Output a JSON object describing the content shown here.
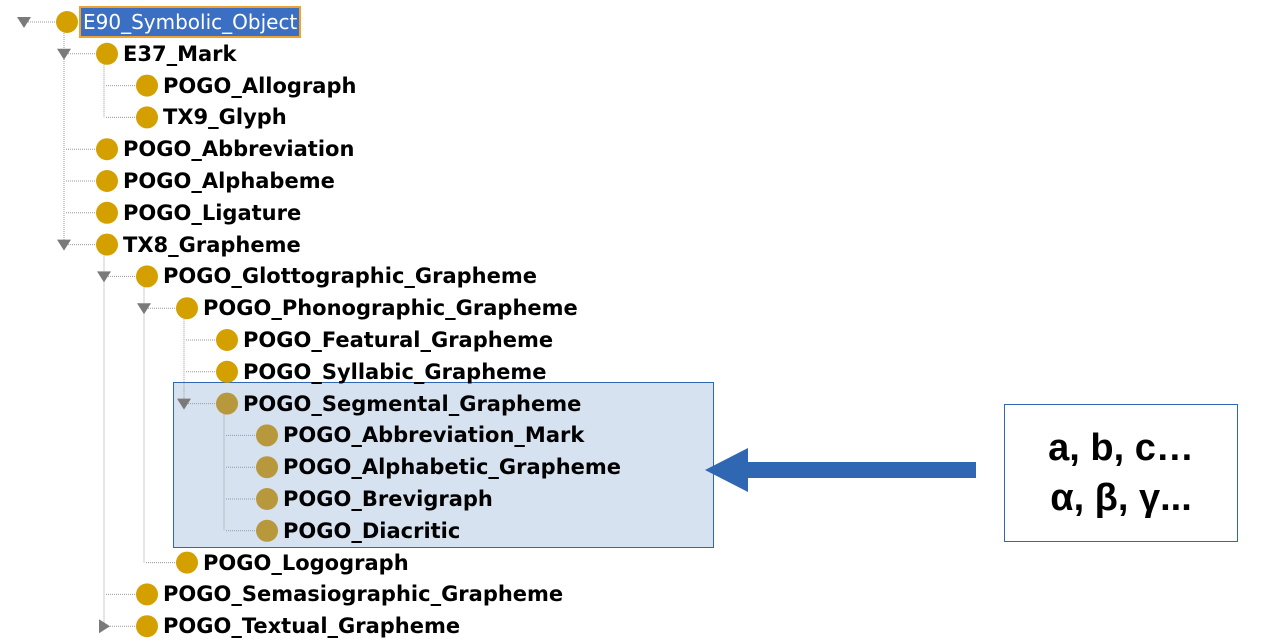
{
  "tree": {
    "nodes": [
      {
        "label": "E90_Symbolic_Object",
        "depth": 0,
        "toggle": "expanded",
        "selected": true
      },
      {
        "label": "E37_Mark",
        "depth": 1,
        "toggle": "expanded"
      },
      {
        "label": "POGO_Allograph",
        "depth": 2,
        "toggle": "leaf"
      },
      {
        "label": "TX9_Glyph",
        "depth": 2,
        "toggle": "leaf"
      },
      {
        "label": "POGO_Abbreviation",
        "depth": 1,
        "toggle": "leaf"
      },
      {
        "label": "POGO_Alphabeme",
        "depth": 1,
        "toggle": "leaf"
      },
      {
        "label": "POGO_Ligature",
        "depth": 1,
        "toggle": "leaf"
      },
      {
        "label": "TX8_Grapheme",
        "depth": 1,
        "toggle": "expanded"
      },
      {
        "label": "POGO_Glottographic_Grapheme",
        "depth": 2,
        "toggle": "expanded"
      },
      {
        "label": "POGO_Phonographic_Grapheme",
        "depth": 3,
        "toggle": "expanded"
      },
      {
        "label": "POGO_Featural_Grapheme",
        "depth": 4,
        "toggle": "leaf"
      },
      {
        "label": "POGO_Syllabic_Grapheme",
        "depth": 4,
        "toggle": "leaf"
      },
      {
        "label": "POGO_Segmental_Grapheme",
        "depth": 4,
        "toggle": "expanded",
        "highlighted": true
      },
      {
        "label": "POGO_Abbreviation_Mark",
        "depth": 5,
        "toggle": "leaf",
        "highlighted": true
      },
      {
        "label": "POGO_Alphabetic_Grapheme",
        "depth": 5,
        "toggle": "leaf",
        "highlighted": true
      },
      {
        "label": "POGO_Brevigraph",
        "depth": 5,
        "toggle": "leaf",
        "highlighted": true
      },
      {
        "label": "POGO_Diacritic",
        "depth": 5,
        "toggle": "leaf",
        "highlighted": true
      },
      {
        "label": "POGO_Logograph",
        "depth": 3,
        "toggle": "leaf"
      },
      {
        "label": "POGO_Semasiographic_Grapheme",
        "depth": 2,
        "toggle": "leaf"
      },
      {
        "label": "POGO_Textual_Grapheme",
        "depth": 2,
        "toggle": "collapsed"
      }
    ]
  },
  "callout": {
    "line1": "a, b, c…",
    "line2": "α, β, γ..."
  },
  "colors": {
    "node_dot": "#d4a000",
    "node_dot_highlighted": "#b8983c",
    "connector_line": "#9a9a9a",
    "toggle_triangle": "#7a7a7a",
    "selection_bg": "#3a6fc4",
    "selection_border": "#f0a22e",
    "highlight_fill": "#bcd0e6",
    "highlight_border": "#2f67b3",
    "arrow": "#2f67b3"
  },
  "icons": {
    "node_icon": "class-circle-icon",
    "expanded_icon": "triangle-down-icon",
    "collapsed_icon": "triangle-right-icon"
  }
}
